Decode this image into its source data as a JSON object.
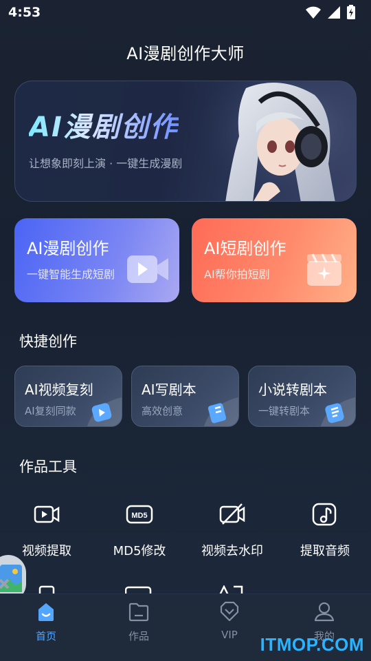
{
  "status_bar": {
    "time": "4:53",
    "icons": [
      "wifi-icon",
      "signal-icon",
      "battery-charging-icon"
    ]
  },
  "header": {
    "title": "AI漫剧创作大师"
  },
  "hero_banner": {
    "title": "AI漫剧创作",
    "subtitle": "让想象即刻上演 · 一键生成漫剧"
  },
  "main_cards": [
    {
      "title": "AI漫剧创作",
      "subtitle": "一键智能生成短剧",
      "icon": "video-play-icon",
      "color": "#4a64f5"
    },
    {
      "title": "AI短剧创作",
      "subtitle": "AI帮你拍短剧",
      "icon": "clapperboard-sparkle-icon",
      "color": "#ff6b56"
    }
  ],
  "quick_section": {
    "title": "快捷创作",
    "items": [
      {
        "title": "AI视频复刻",
        "subtitle": "AI复刻同款"
      },
      {
        "title": "AI写剧本",
        "subtitle": "高效创意"
      },
      {
        "title": "小说转剧本",
        "subtitle": "一键转剧本"
      }
    ]
  },
  "tools_section": {
    "title": "作品工具",
    "items": [
      {
        "label": "视频提取",
        "icon": "video-extract-icon"
      },
      {
        "label": "MD5修改",
        "icon": "md5-icon",
        "icon_text": "MD5"
      },
      {
        "label": "视频去水印",
        "icon": "video-off-icon"
      },
      {
        "label": "提取音频",
        "icon": "music-note-icon"
      }
    ]
  },
  "tab_bar": {
    "tabs": [
      {
        "label": "首页",
        "icon": "home-icon",
        "active": true
      },
      {
        "label": "作品",
        "icon": "folder-icon",
        "active": false
      },
      {
        "label": "VIP",
        "icon": "vip-heart-icon",
        "active": false
      },
      {
        "label": "我的",
        "icon": "user-icon",
        "active": false
      }
    ]
  },
  "watermark": "ITMOP.COM",
  "colors": {
    "background": "#1b2332",
    "accent_blue": "#53a6ff",
    "card_blue": "#4a64f5",
    "card_orange": "#ff6b56",
    "watermark": "#2bb3ff"
  }
}
